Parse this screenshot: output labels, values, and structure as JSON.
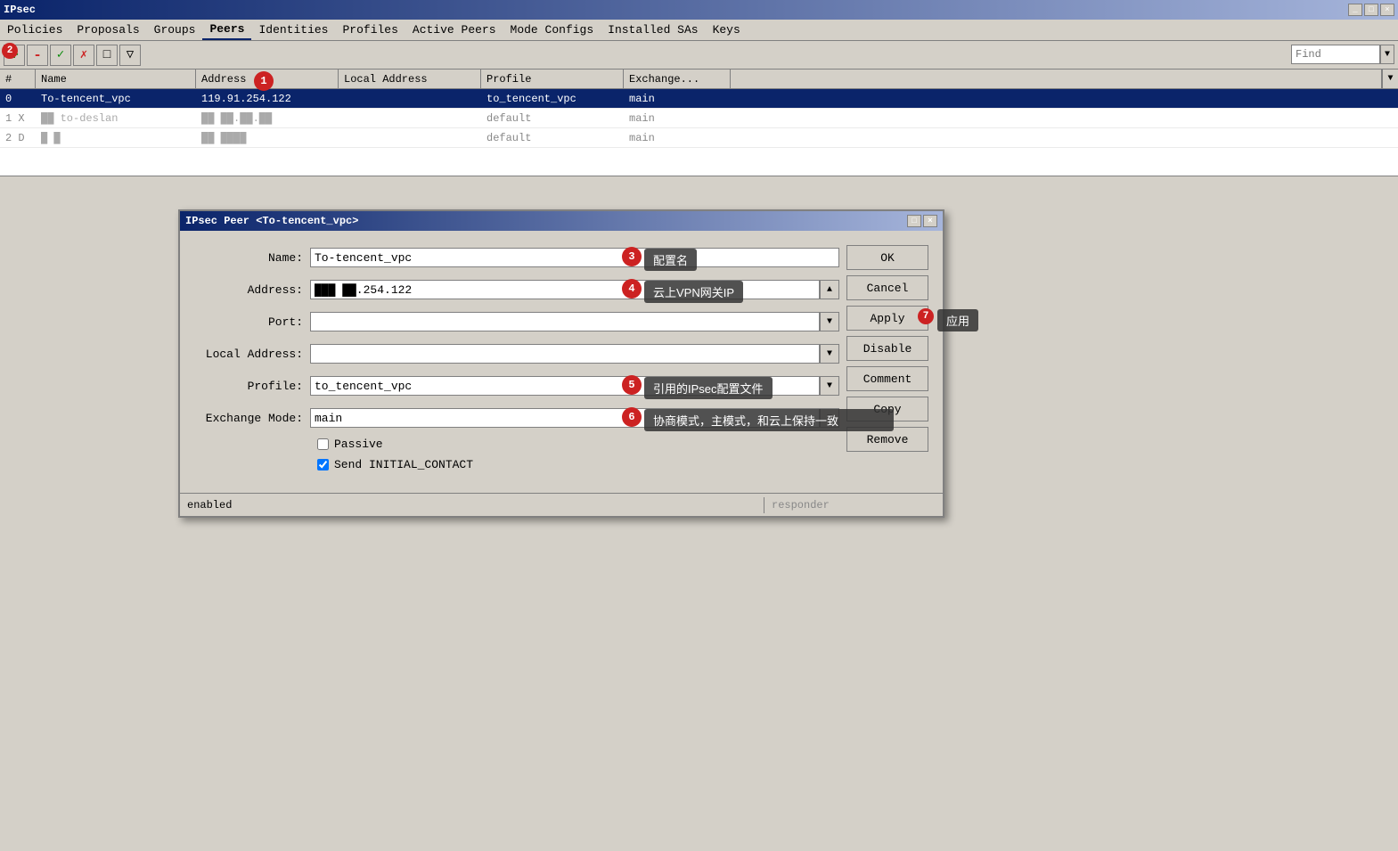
{
  "window": {
    "title": "IPsec",
    "title_buttons": [
      "□",
      "×"
    ]
  },
  "menu": {
    "items": [
      "Policies",
      "Proposals",
      "Groups",
      "Peers",
      "Identities",
      "Profiles",
      "Active Peers",
      "Mode Configs",
      "Installed SAs",
      "Keys"
    ]
  },
  "tabs": {
    "active": "Peers",
    "items": [
      "Peers"
    ]
  },
  "toolbar": {
    "buttons": [
      "+",
      "-",
      "✓",
      "✗",
      "□",
      "▽"
    ],
    "find_placeholder": "Find"
  },
  "table": {
    "columns": [
      "#",
      "Name",
      "Address",
      "Local Address",
      "Profile",
      "Exchange..."
    ],
    "rows": [
      {
        "num": "0",
        "name": "To-tencent_vpc",
        "address": "119.91.254.122",
        "local_address": "",
        "profile": "to_tencent_vpc",
        "exchange": "main",
        "selected": true
      },
      {
        "num": "1 X",
        "name": "██ to-deslan",
        "address": "██ ██.██.██",
        "local_address": "",
        "profile": "default",
        "exchange": "main",
        "selected": false,
        "blurred": true
      },
      {
        "num": "2 D",
        "name": "█ █",
        "address": "██ ████",
        "local_address": "",
        "profile": "default",
        "exchange": "main",
        "selected": false,
        "blurred": true
      }
    ]
  },
  "dialog": {
    "title": "IPsec Peer <To-tencent_vpc>",
    "title_buttons": [
      "□",
      "×"
    ],
    "fields": {
      "name_label": "Name:",
      "name_value": "To-tencent_vpc",
      "address_label": "Address:",
      "address_value": "███ ██.254.122",
      "port_label": "Port:",
      "port_value": "",
      "local_address_label": "Local Address:",
      "local_address_value": "",
      "profile_label": "Profile:",
      "profile_value": "to_tencent_vpc",
      "exchange_mode_label": "Exchange Mode:",
      "exchange_mode_value": "main",
      "passive_label": "Passive",
      "passive_checked": false,
      "send_initial_label": "Send INITIAL_CONTACT",
      "send_initial_checked": true
    },
    "buttons": [
      "OK",
      "Cancel",
      "Apply",
      "Disable",
      "Comment",
      "Copy",
      "Remove"
    ],
    "status_left": "enabled",
    "status_right": "responder"
  },
  "annotations": [
    {
      "id": 3,
      "text": "配置名",
      "badge": "3"
    },
    {
      "id": 4,
      "text": "云上VPN网关IP",
      "badge": "4"
    },
    {
      "id": 5,
      "text": "引用的IPsec配置文件",
      "badge": "5"
    },
    {
      "id": 6,
      "text": "协商模式，主模式，和云上保持一致",
      "badge": "6"
    },
    {
      "id": 7,
      "text": "应用",
      "badge": "7"
    }
  ],
  "badge2": "2",
  "badge1": "1"
}
